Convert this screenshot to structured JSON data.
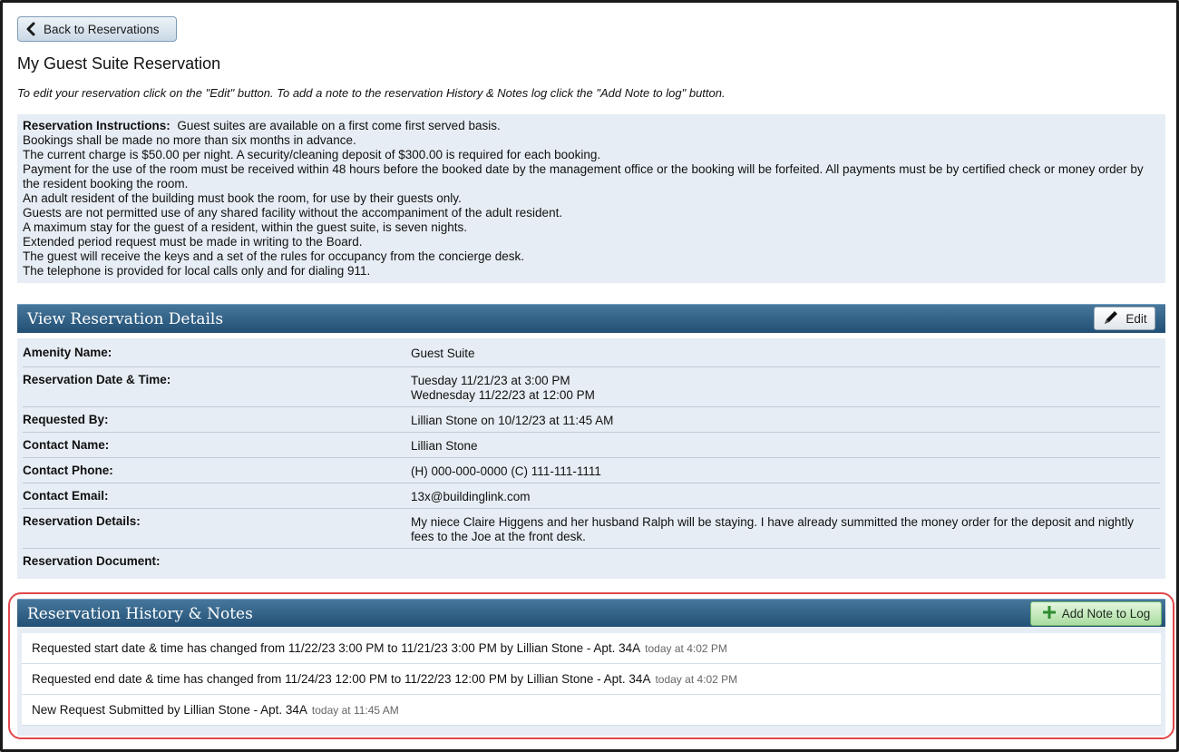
{
  "back_button": {
    "label": "Back to Reservations",
    "icon": "chevron-left-icon"
  },
  "page_title": "My Guest Suite Reservation",
  "intro": "To edit your reservation click on the \"Edit\" button. To add a note to the reservation History & Notes log click the \"Add Note to log\" button.",
  "instructions": {
    "lead": "Reservation Instructions:",
    "first_line": "Guest suites are available on a first come first served basis.",
    "lines": [
      "Bookings shall be made no more than six months in advance.",
      "The current charge is $50.00 per night. A security/cleaning deposit of $300.00 is required for each booking.",
      "Payment for the use of the room must be received within 48 hours before the booked date by the management office or the booking will be forfeited. All payments must be by certified check or money order by the resident booking the room.",
      "An adult resident of the building must book the room, for use by their guests only.",
      "Guests are not permitted use of any shared facility without the accompaniment of the adult resident.",
      "A maximum stay for the guest of a resident, within the guest suite, is seven nights.",
      "Extended period request must be made in writing to the Board.",
      "The guest will receive the keys and a set of the rules for occupancy from the concierge desk.",
      "The telephone is provided for local calls only and for dialing 911."
    ]
  },
  "details_section": {
    "title": "View Reservation Details",
    "edit_label": "Edit",
    "edit_icon": "pen-icon",
    "rows": [
      {
        "label": "Amenity Name:",
        "value": "Guest Suite"
      },
      {
        "label": "Reservation Date & Time:",
        "value": "Tuesday 11/21/23 at 3:00 PM",
        "value2": "Wednesday 11/22/23 at 12:00 PM"
      },
      {
        "label": "Requested By:",
        "value": "Lillian Stone on 10/12/23 at 11:45 AM"
      },
      {
        "label": "Contact Name:",
        "value": "Lillian Stone"
      },
      {
        "label": "Contact Phone:",
        "value": "(H) 000-000-0000 (C) 111-111-1111"
      },
      {
        "label": "Contact Email:",
        "value": "13x@buildinglink.com"
      },
      {
        "label": "Reservation Details:",
        "value": "My niece Claire Higgens and her husband Ralph will be staying. I have already summitted the money order for the deposit and nightly fees to the Joe at the front desk."
      },
      {
        "label": "Reservation Document:",
        "value": ""
      }
    ]
  },
  "history_section": {
    "title": "Reservation History & Notes",
    "add_label": "Add Note to Log",
    "add_icon": "plus-icon",
    "items": [
      {
        "text": "Requested start date & time has changed from 11/22/23 3:00 PM to 11/21/23 3:00 PM by Lillian Stone - Apt. 34A",
        "when": "today at 4:02 PM"
      },
      {
        "text": "Requested end date & time has changed from 11/24/23 12:00 PM to 11/22/23 12:00 PM by Lillian Stone - Apt. 34A",
        "when": "today at 4:02 PM"
      },
      {
        "text": "New Request Submitted by Lillian Stone - Apt. 34A",
        "when": "today at 11:45 AM"
      }
    ]
  },
  "colors": {
    "section_header": "#2f5f86",
    "panel_bg": "#e6edf4",
    "highlight_border": "#e0474c",
    "add_button": "#a9dca0"
  }
}
